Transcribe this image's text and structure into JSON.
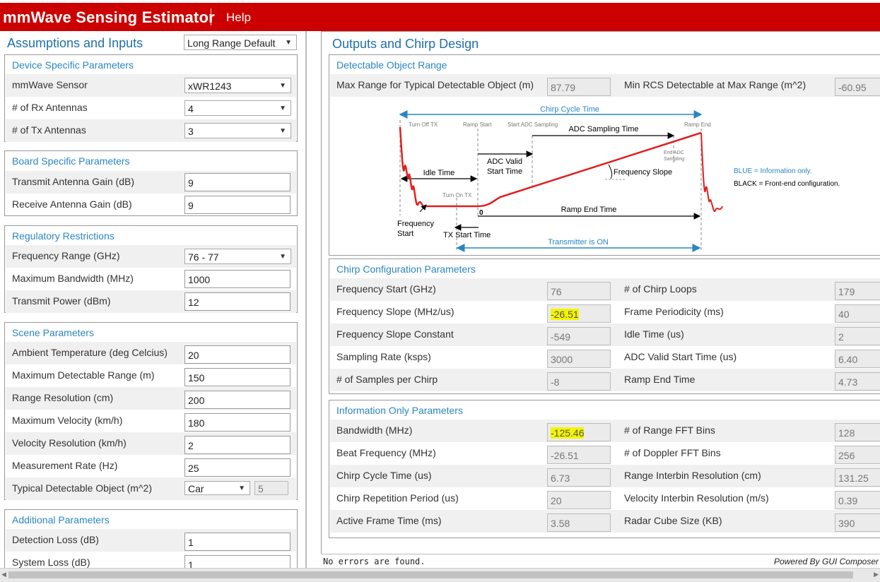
{
  "app": {
    "title": "mmWave Sensing Estimator",
    "help": "Help"
  },
  "left": {
    "title": "Assumptions and Inputs",
    "preset": "Long Range Default",
    "device": {
      "title": "Device Specific Parameters",
      "sensor_label": "mmWave Sensor",
      "sensor_value": "xWR1243",
      "rx_label": "# of Rx Antennas",
      "rx_value": "4",
      "tx_label": "# of Tx Antennas",
      "tx_value": "3"
    },
    "board": {
      "title": "Board Specific Parameters",
      "tx_gain_label": "Transmit Antenna Gain (dB)",
      "tx_gain_value": "9",
      "rx_gain_label": "Receive Antenna Gain (dB)",
      "rx_gain_value": "9"
    },
    "regulatory": {
      "title": "Regulatory Restrictions",
      "freq_label": "Frequency Range (GHz)",
      "freq_value": "76 - 77",
      "bw_label": "Maximum Bandwidth (MHz)",
      "bw_value": "1000",
      "power_label": "Transmit Power (dBm)",
      "power_value": "12"
    },
    "scene": {
      "title": "Scene Parameters",
      "temp_label": "Ambient Temperature (deg Celcius)",
      "temp_value": "20",
      "range_label": "Maximum Detectable Range (m)",
      "range_value": "150",
      "res_label": "Range Resolution (cm)",
      "res_value": "200",
      "vel_label": "Maximum Velocity (km/h)",
      "vel_value": "180",
      "velres_label": "Velocity Resolution (km/h)",
      "velres_value": "2",
      "rate_label": "Measurement Rate (Hz)",
      "rate_value": "25",
      "obj_label": "Typical Detectable Object (m^2)",
      "obj_value": "Car",
      "obj_rcs": "5"
    },
    "additional": {
      "title": "Additional Parameters",
      "det_loss_label": "Detection Loss (dB)",
      "det_loss_value": "1",
      "sys_loss_label": "System Loss (dB)",
      "sys_loss_value": "1"
    }
  },
  "right": {
    "title": "Outputs and Chirp Design",
    "detectable": {
      "title": "Detectable Object Range",
      "max_range_label": "Max Range for Typical Detectable Object (m)",
      "max_range_value": "87.79",
      "min_rcs_label": "Min RCS Detectable at Max Range (m^2)",
      "min_rcs_value": "-60.95"
    },
    "diagram": {
      "chirp_cycle_time": "Chirp Cycle Time",
      "turn_off_tx": "Turn Off TX",
      "ramp_start": "Ramp Start",
      "start_adc_sampling": "Start ADC Sampling",
      "adc_sampling_time": "ADC Sampling Time",
      "ramp_end": "Ramp End",
      "end_adc_1": "End ADC",
      "end_adc_2": "Sampling",
      "adc_valid_1": "ADC Valid",
      "adc_valid_2": "Start Time",
      "idle_time": "Idle Time",
      "frequency_slope": "Frequency Slope",
      "turn_on_tx": "Turn On TX",
      "zero": "0",
      "ramp_end_time": "Ramp End Time",
      "frequency_start_1": "Frequency",
      "frequency_start_2": "Start",
      "tx_start_time": "TX Start Time",
      "transmitter_on": "Transmitter is ON",
      "legend_blue": "BLUE = Information only.",
      "legend_black": "BLACK = Front-end configuration."
    },
    "chirp": {
      "title": "Chirp Configuration Parameters",
      "rows": [
        {
          "l1": "Frequency Start (GHz)",
          "v1": "76",
          "l2": "# of Chirp Loops",
          "v2": "179"
        },
        {
          "l1": "Frequency Slope (MHz/us)",
          "v1": "-26.51",
          "l2": "Frame Periodicity (ms)",
          "v2": "40"
        },
        {
          "l1": "Frequency Slope Constant",
          "v1": "-549",
          "l2": "Idle Time (us)",
          "v2": "2"
        },
        {
          "l1": "Sampling Rate (ksps)",
          "v1": "3000",
          "l2": "ADC Valid Start Time (us)",
          "v2": "6.40"
        },
        {
          "l1": "# of Samples per Chirp",
          "v1": "-8",
          "l2": "Ramp End Time",
          "v2": "4.73"
        }
      ]
    },
    "info": {
      "title": "Information Only Parameters",
      "rows": [
        {
          "l1": "Bandwidth (MHz)",
          "v1": "-125.46",
          "l2": "# of Range FFT Bins",
          "v2": "128"
        },
        {
          "l1": "Beat Frequency (MHz)",
          "v1": "-26.51",
          "l2": "# of Doppler FFT Bins",
          "v2": "256"
        },
        {
          "l1": "Chirp Cycle Time (us)",
          "v1": "6.73",
          "l2": "Range Interbin Resolution (cm)",
          "v2": "131.25"
        },
        {
          "l1": "Chirp Repetition Period (us)",
          "v1": "20",
          "l2": "Velocity Interbin Resolution (m/s)",
          "v2": "0.39"
        },
        {
          "l1": "Active Frame Time (ms)",
          "v1": "3.58",
          "l2": "Radar Cube Size (KB)",
          "v2": "390"
        }
      ]
    }
  },
  "status": {
    "message": "No errors are found.",
    "powered_by": "Powered By GUI Composer"
  },
  "colors": {
    "header": "#cc0000",
    "accent": "#2a86c2",
    "highlight": "#f4f400",
    "chirp_line": "#e02020"
  }
}
